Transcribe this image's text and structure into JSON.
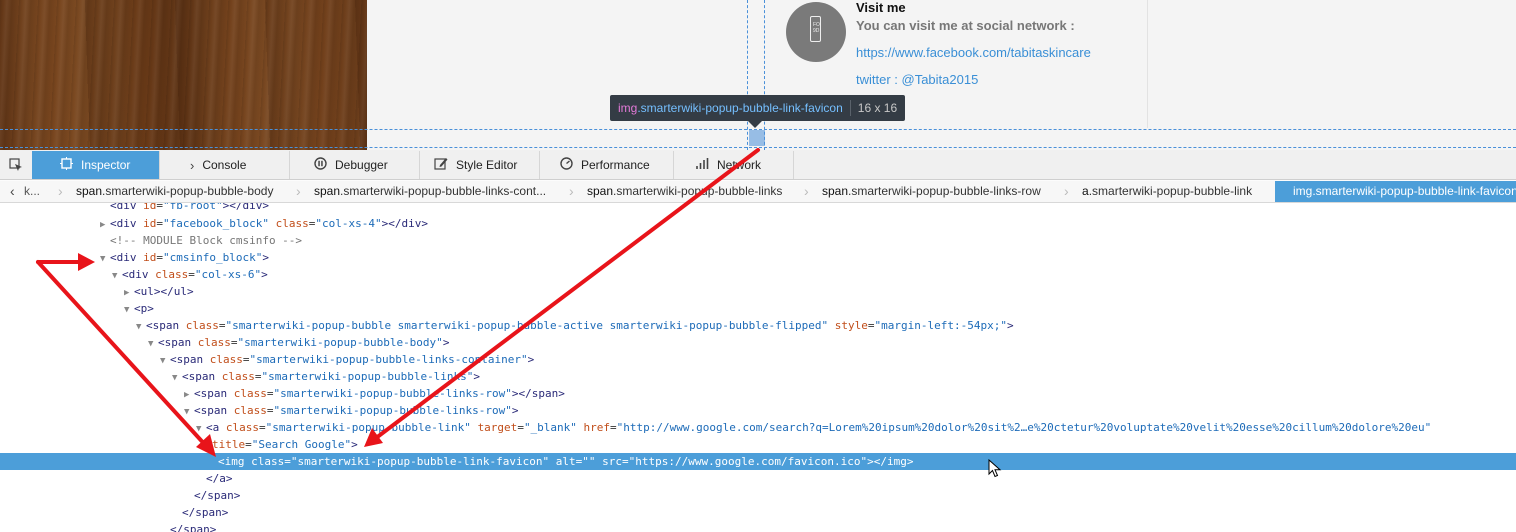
{
  "preview": {
    "visit_title": "Visit me",
    "visit_subtitle": "You can visit me at social network :",
    "facebook_link": "https://www.facebook.com/tabitaskincare",
    "twitter_link": "twitter : @Tabita2015",
    "avatar_icon": "phone-icon",
    "avatar_text": "FO 9D"
  },
  "tooltip": {
    "tag": "img",
    "class": ".smarterwiki-popup-bubble-link-favicon",
    "dims": "16 x 16"
  },
  "toolbar": {
    "tabs": [
      {
        "label": "Inspector",
        "icon": "inspector-icon"
      },
      {
        "label": "Console",
        "icon": "console-icon"
      },
      {
        "label": "Debugger",
        "icon": "debugger-icon"
      },
      {
        "label": "Style Editor",
        "icon": "style-editor-icon"
      },
      {
        "label": "Performance",
        "icon": "performance-icon"
      },
      {
        "label": "Network",
        "icon": "network-icon"
      }
    ]
  },
  "breadcrumbs": [
    {
      "tag": "span",
      "cls": ".smarterwiki-popup-bubble-body"
    },
    {
      "tag": "span",
      "cls": ".smarterwiki-popup-bubble-links-cont..."
    },
    {
      "tag": "span",
      "cls": ".smarterwiki-popup-bubble-links"
    },
    {
      "tag": "span",
      "cls": ".smarterwiki-popup-bubble-links-row"
    },
    {
      "tag": "a",
      "cls": ".smarterwiki-popup-bubble-link"
    },
    {
      "tag": "img",
      "cls": ".smarterwiki-popup-bubble-link-favicon"
    }
  ],
  "tree": {
    "l0": {
      "t1": "<div ",
      "a1": "id",
      "v1": "\"fb-root\"",
      "t2": "></div>"
    },
    "l1": {
      "t1": "<div ",
      "a1": "id",
      "v1": "\"facebook_block\"",
      "a2": "class",
      "v2": "\"col-xs-4\"",
      "t2": "></div>"
    },
    "l2": {
      "c": "<!-- MODULE Block cmsinfo -->"
    },
    "l3": {
      "t1": "<div ",
      "a1": "id",
      "v1": "\"cmsinfo_block\"",
      "t2": ">"
    },
    "l4": {
      "t1": "<div ",
      "a1": "class",
      "v1": "\"col-xs-6\"",
      "t2": ">"
    },
    "l5": {
      "t1": "<ul></ul>"
    },
    "l6": {
      "t1": "<p>"
    },
    "l7": {
      "t1": "<span ",
      "a1": "class",
      "v1": "\"smarterwiki-popup-bubble smarterwiki-popup-bubble-active smarterwiki-popup-bubble-flipped\"",
      "a2": "style",
      "v2": "\"margin-left:-54px;\"",
      "t2": ">"
    },
    "l8": {
      "t1": "<span ",
      "a1": "class",
      "v1": "\"smarterwiki-popup-bubble-body\"",
      "t2": ">"
    },
    "l9": {
      "t1": "<span ",
      "a1": "class",
      "v1": "\"smarterwiki-popup-bubble-links-container\"",
      "t2": ">"
    },
    "l10": {
      "t1": "<span ",
      "a1": "class",
      "v1": "\"smarterwiki-popup-bubble-links\"",
      "t2": ">"
    },
    "l11": {
      "t1": "<span ",
      "a1": "class",
      "v1": "\"smarterwiki-popup-bubble-links-row\"",
      "t2": "></span>"
    },
    "l12": {
      "t1": "<span ",
      "a1": "class",
      "v1": "\"smarterwiki-popup-bubble-links-row\"",
      "t2": ">"
    },
    "l13": {
      "t1": "<a ",
      "a1": "class",
      "v1": "\"smarterwiki-popup-bubble-link\"",
      "a2": "target",
      "v2": "\"_blank\"",
      "a3": "href",
      "v3": "\"http://www.google.com/search?q=Lorem%20ipsum%20dolor%20sit%2…e%20ctetur%20voluptate%20velit%20esse%20cillum%20dolore%20eu\""
    },
    "l14": {
      "a1": "title",
      "v1": "\"Search Google\"",
      "t2": ">"
    },
    "l15": {
      "t1": "<img ",
      "a1": "class",
      "v1": "\"smarterwiki-popup-bubble-link-favicon\"",
      "a2": "alt",
      "v2": "\"\"",
      "a3": "src",
      "v3": "\"https://www.google.com/favicon.ico\"",
      "t2": "></img>"
    },
    "l16": {
      "t1": "</a>"
    },
    "l17": {
      "t1": "</span>"
    },
    "l18": {
      "t1": "</span>"
    },
    "l19": {
      "t1": "</span>"
    }
  },
  "colors": {
    "accent": "#4c9ed9",
    "annotation": "#e8141a"
  }
}
